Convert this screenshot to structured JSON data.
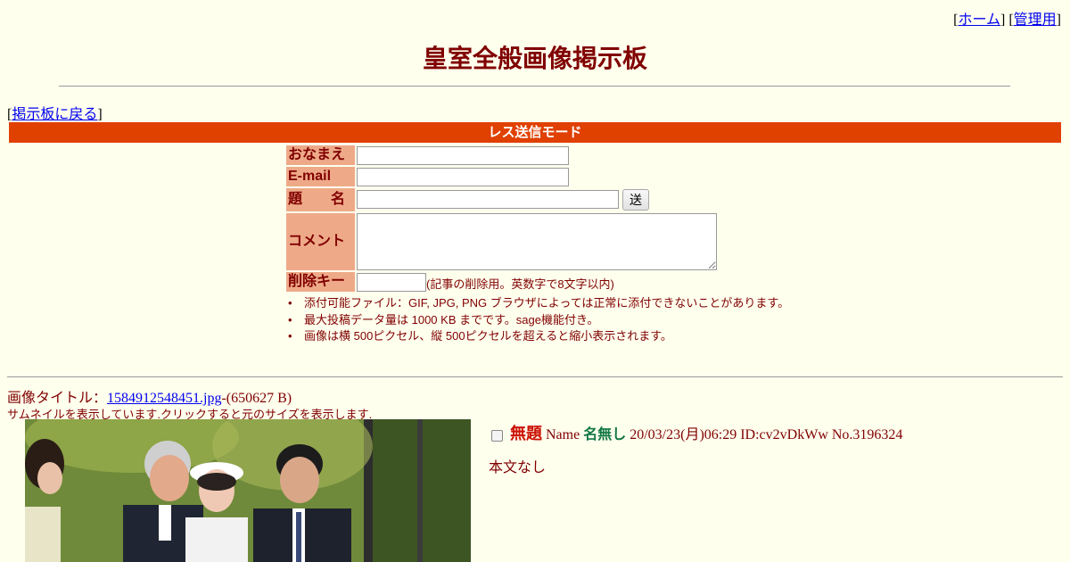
{
  "toplinks": {
    "home": "ホーム",
    "admin": "管理用"
  },
  "page_title": "皇室全般画像掲示板",
  "back_link": "掲示板に戻る",
  "mode_bar": "レス送信モード",
  "form": {
    "name_label": "おなまえ",
    "email_label": "E-mail",
    "subject_label": "題　　名",
    "submit_label": "送信する",
    "comment_label": "コメント",
    "delkey_label": "削除キー",
    "delkey_note": "(記事の削除用。英数字で8文字以内)"
  },
  "notes": [
    "添付可能ファイル：GIF, JPG, PNG ブラウザによっては正常に添付できないことがあります。",
    "最大投稿データ量は 1000 KB までです。sage機能付き。",
    " 画像は横 500ピクセル、縦 500ピクセルを超えると縮小表示されます。"
  ],
  "image": {
    "title_prefix": "画像タイトル：",
    "filename": "1584912548451.jpg",
    "size": "-(650627 B)",
    "thumb_note": "サムネイルを表示しています.クリックすると元のサイズを表示します."
  },
  "post": {
    "subject": "無題",
    "name_prefix": "Name",
    "name": "名無し",
    "meta": "20/03/23(月)06:29 ID:cv2vDkWw No.3196324",
    "body": "本文なし"
  }
}
